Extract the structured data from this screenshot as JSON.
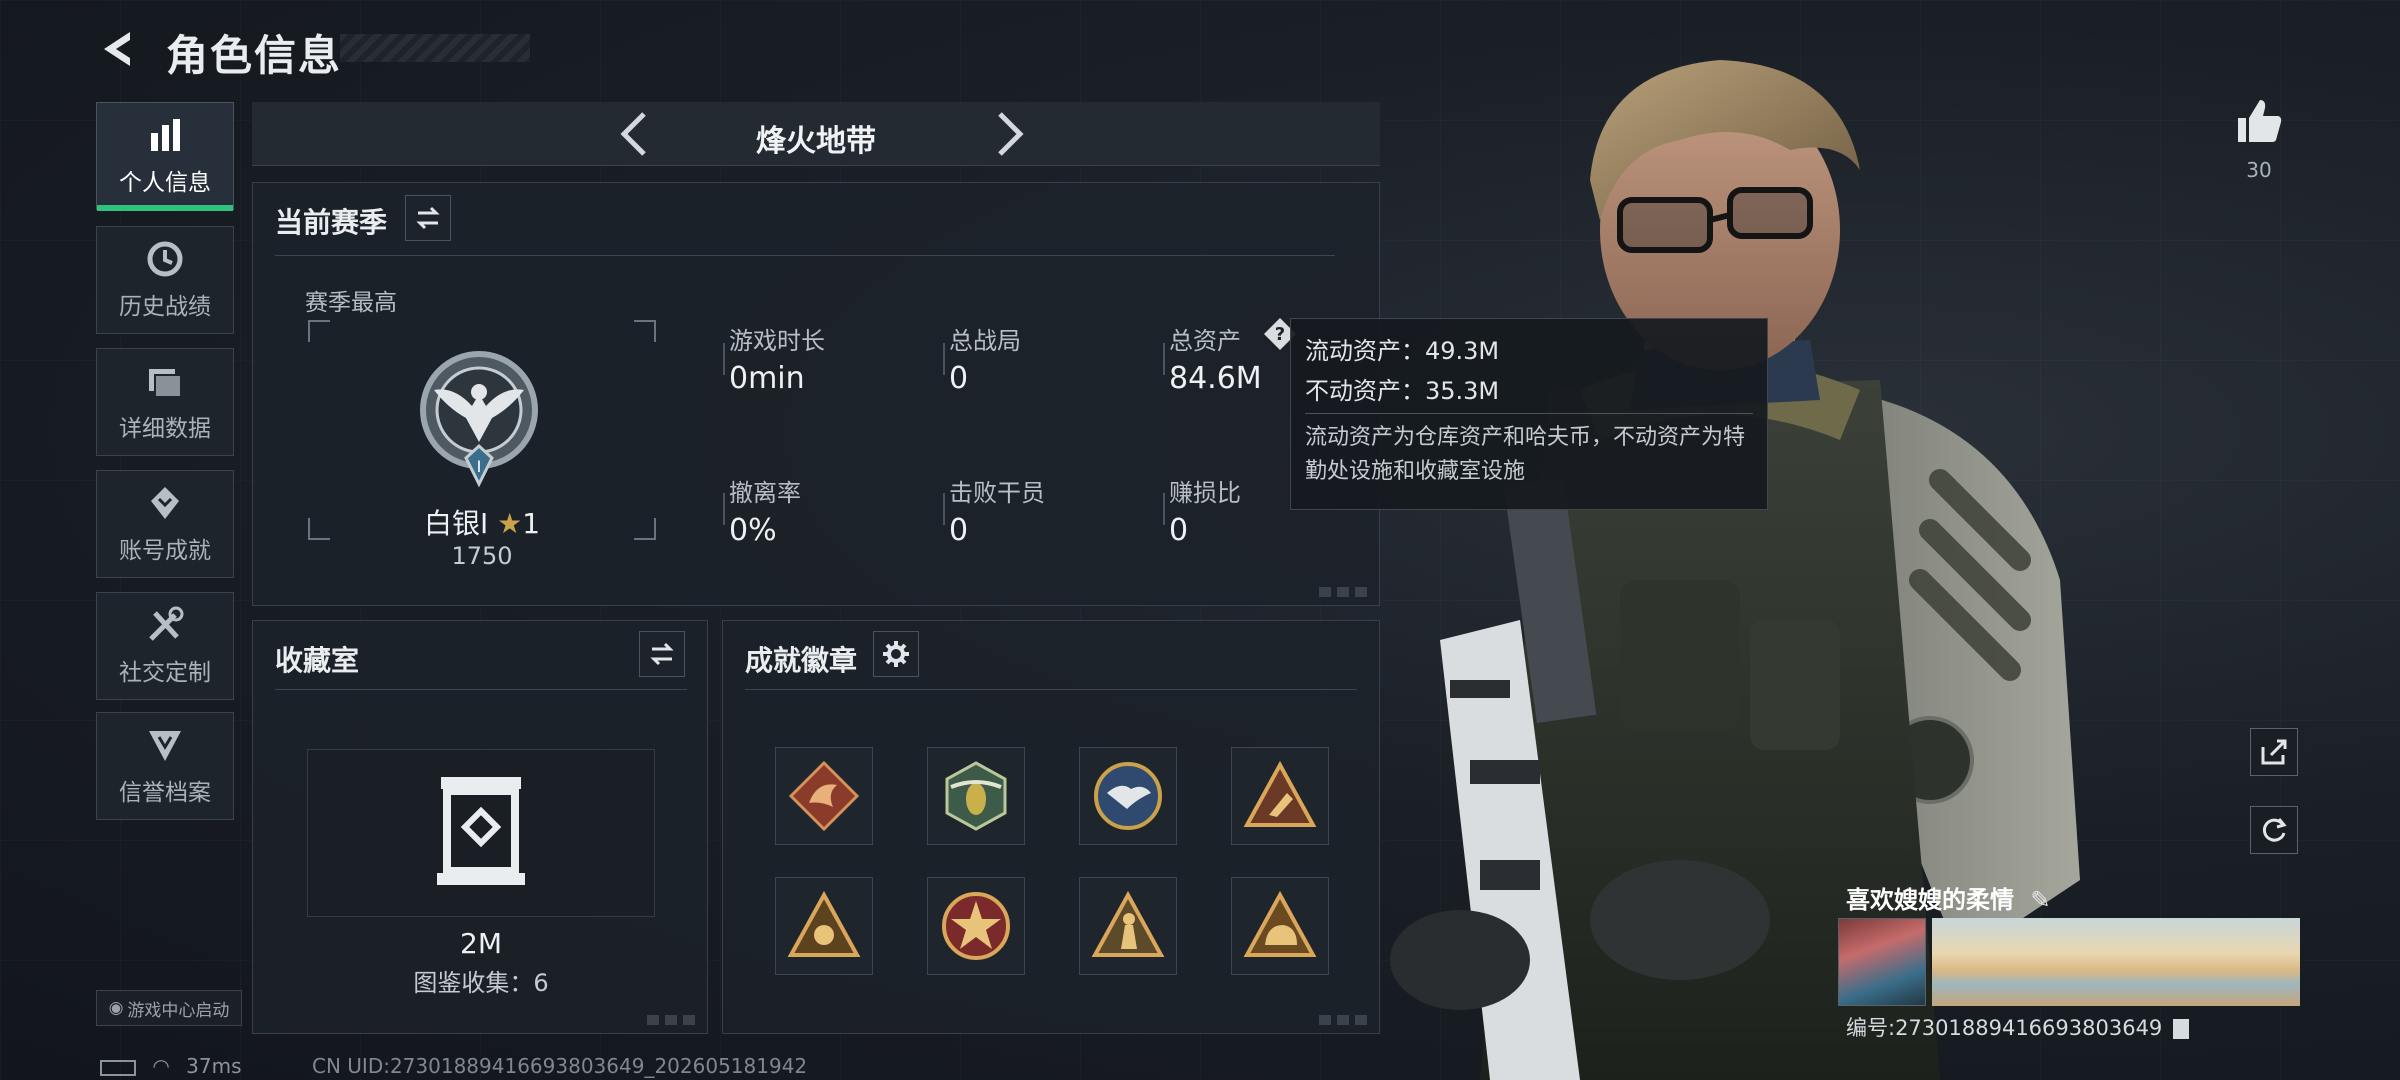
{
  "header": {
    "title": "角色信息"
  },
  "sidebar": {
    "items": [
      {
        "label": "个人信息",
        "icon": "bar-chart-icon",
        "active": true
      },
      {
        "label": "历史战绩",
        "icon": "clock-icon",
        "active": false
      },
      {
        "label": "详细数据",
        "icon": "folder-icon",
        "active": false
      },
      {
        "label": "账号成就",
        "icon": "achievement-icon",
        "active": false
      },
      {
        "label": "社交定制",
        "icon": "tools-icon",
        "active": false
      },
      {
        "label": "信誉档案",
        "icon": "shield-icon",
        "active": false
      }
    ],
    "game_center": "游戏中心启动"
  },
  "mode": {
    "title": "烽火地带"
  },
  "season": {
    "title": "当前赛季",
    "best_label": "赛季最高",
    "rank_name": "白银I",
    "rank_stars": "1",
    "rank_points": "1750",
    "stats": [
      {
        "label": "游戏时长",
        "value": "0min"
      },
      {
        "label": "总战局",
        "value": "0"
      },
      {
        "label": "总资产",
        "value": "84.6M"
      },
      {
        "label": "撤离率",
        "value": "0%"
      },
      {
        "label": "击败干员",
        "value": "0"
      },
      {
        "label": "赚损比",
        "value": "0"
      }
    ]
  },
  "tooltip": {
    "liquid": "流动资产：49.3M",
    "fixed": "不动资产：35.3M",
    "desc": "流动资产为仓库资产和哈夫币，不动资产为特勤处设施和收藏室设施"
  },
  "collection": {
    "title": "收藏室",
    "value": "2M",
    "codex": "图鉴收集：6"
  },
  "badges": {
    "title": "成就徽章",
    "items": [
      "dragon-badge",
      "wasp-badge",
      "eagle-badge",
      "triangle-badge",
      "triangle-badge-2",
      "star-badge",
      "soldier-badge",
      "helmet-badge"
    ]
  },
  "profile": {
    "likes": "30",
    "name": "喜欢嫂嫂的柔情",
    "id": "编号:27301889416693803649"
  },
  "status": {
    "ping": "37ms",
    "uid": "CN UID:27301889416693803649_202605181942"
  },
  "colors": {
    "accent": "#2ec27e",
    "gold": "#c9a24a",
    "bg": "#151a21"
  }
}
